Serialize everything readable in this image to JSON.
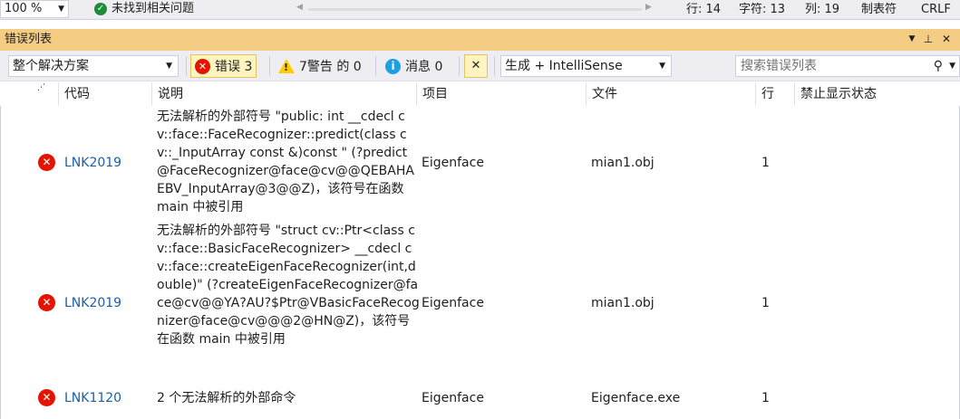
{
  "status_bar": {
    "zoom": "100 %",
    "issues": "未找到相关问题",
    "line": "行: 14",
    "char": "字符: 13",
    "col": "列: 19",
    "tab": "制表符",
    "eol": "CRLF"
  },
  "panel": {
    "title": "错误列表"
  },
  "toolbar": {
    "scope": "整个解决方案",
    "errors": "错误 3",
    "warnings": "7警告 的 0",
    "messages": "消息 0",
    "build_filter": "生成 + IntelliSense",
    "search_placeholder": "搜索错误列表"
  },
  "columns": {
    "code": "代码",
    "description": "说明",
    "project": "项目",
    "file": "文件",
    "line": "行",
    "suppression": "禁止显示状态"
  },
  "rows": [
    {
      "code": "LNK2019",
      "description": "无法解析的外部符号 \"public: int __cdecl cv::face::FaceRecognizer::predict(class cv::_InputArray const &)const \" (?predict@FaceRecognizer@face@cv@@QEBAHAEBV_InputArray@3@@Z)，该符号在函数 main 中被引用",
      "project": "Eigenface",
      "file": "mian1.obj",
      "line": "1"
    },
    {
      "code": "LNK2019",
      "description": "无法解析的外部符号 \"struct cv::Ptr<class cv::face::BasicFaceRecognizer> __cdecl cv::face::createEigenFaceRecognizer(int,double)\" (?createEigenFaceRecognizer@face@cv@@YA?AU?$Ptr@VBasicFaceRecognizer@face@cv@@@2@HN@Z)，该符号在函数 main 中被引用",
      "project": "Eigenface",
      "file": "mian1.obj",
      "line": "1"
    },
    {
      "code": "LNK1120",
      "description": "2 个无法解析的外部命令",
      "project": "Eigenface",
      "file": "Eigenface.exe",
      "line": "1"
    }
  ]
}
